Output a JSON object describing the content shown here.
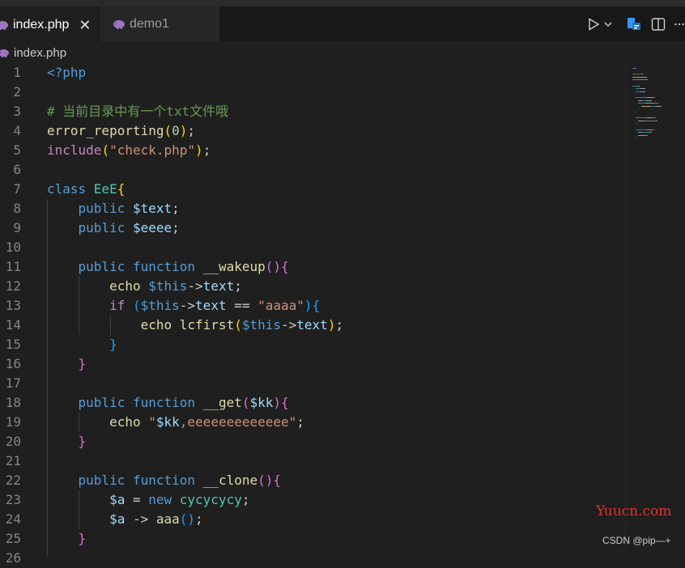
{
  "tabs": [
    {
      "label": "index.php",
      "active": true,
      "close_glyph": "✕",
      "icon": "php-elephant-icon"
    },
    {
      "label": "demo1",
      "active": false,
      "icon": "php-elephant-icon"
    }
  ],
  "breadcrumb": {
    "file": "index.php",
    "icon": "php-elephant-icon"
  },
  "actions": [
    "run-icon",
    "run-dropdown-icon",
    "remote-explorer-icon",
    "split-editor-icon",
    "more-actions-icon"
  ],
  "colors": {
    "editor_bg": "#1f1f1f",
    "keyword_blue": "#569cd6",
    "keyword_purple": "#c586c0",
    "variable": "#9cdcfe",
    "function": "#dcdcaa",
    "string": "#ce9178",
    "comment": "#6a9955",
    "number": "#b5cea8",
    "class": "#4ec9b0",
    "bracket_gold": "#ffd700",
    "bracket_pink": "#da70d6",
    "bracket_blue": "#179fff"
  },
  "code_lines": [
    {
      "n": "1",
      "tokens": [
        {
          "t": "<?php",
          "c": "#569cd6"
        }
      ]
    },
    {
      "n": "2",
      "tokens": []
    },
    {
      "n": "3",
      "tokens": [
        {
          "t": "# 当前目录中有一个txt文件哦",
          "c": "#6a9955"
        }
      ]
    },
    {
      "n": "4",
      "tokens": [
        {
          "t": "error_reporting",
          "c": "#dcdcaa"
        },
        {
          "t": "(",
          "c": "#ffd700"
        },
        {
          "t": "0",
          "c": "#b5cea8"
        },
        {
          "t": ")",
          "c": "#ffd700"
        },
        {
          "t": ";",
          "c": "#cccccc"
        }
      ]
    },
    {
      "n": "5",
      "tokens": [
        {
          "t": "include",
          "c": "#c586c0"
        },
        {
          "t": "(",
          "c": "#ffd700"
        },
        {
          "t": "\"check.php\"",
          "c": "#ce9178"
        },
        {
          "t": ")",
          "c": "#ffd700"
        },
        {
          "t": ";",
          "c": "#cccccc"
        }
      ]
    },
    {
      "n": "6",
      "tokens": []
    },
    {
      "n": "7",
      "tokens": [
        {
          "t": "class ",
          "c": "#569cd6"
        },
        {
          "t": "EeE",
          "c": "#4ec9b0"
        },
        {
          "t": "{",
          "c": "#ffd700"
        }
      ]
    },
    {
      "n": "8",
      "tokens": [
        {
          "t": "    ",
          "c": "#cccccc"
        },
        {
          "t": "public ",
          "c": "#569cd6"
        },
        {
          "t": "$text",
          "c": "#9cdcfe"
        },
        {
          "t": ";",
          "c": "#cccccc"
        }
      ]
    },
    {
      "n": "9",
      "tokens": [
        {
          "t": "    ",
          "c": "#cccccc"
        },
        {
          "t": "public ",
          "c": "#569cd6"
        },
        {
          "t": "$eeee",
          "c": "#9cdcfe"
        },
        {
          "t": ";",
          "c": "#cccccc"
        }
      ]
    },
    {
      "n": "10",
      "tokens": []
    },
    {
      "n": "11",
      "tokens": [
        {
          "t": "    ",
          "c": "#cccccc"
        },
        {
          "t": "public ",
          "c": "#569cd6"
        },
        {
          "t": "function ",
          "c": "#569cd6"
        },
        {
          "t": "__wakeup",
          "c": "#dcdcaa"
        },
        {
          "t": "()",
          "c": "#da70d6"
        },
        {
          "t": "{",
          "c": "#da70d6"
        }
      ]
    },
    {
      "n": "12",
      "tokens": [
        {
          "t": "        ",
          "c": "#cccccc"
        },
        {
          "t": "echo ",
          "c": "#dcdcaa"
        },
        {
          "t": "$this",
          "c": "#569cd6"
        },
        {
          "t": "->",
          "c": "#cccccc"
        },
        {
          "t": "text",
          "c": "#9cdcfe"
        },
        {
          "t": ";",
          "c": "#cccccc"
        }
      ]
    },
    {
      "n": "13",
      "tokens": [
        {
          "t": "        ",
          "c": "#cccccc"
        },
        {
          "t": "if ",
          "c": "#c586c0"
        },
        {
          "t": "(",
          "c": "#179fff"
        },
        {
          "t": "$this",
          "c": "#569cd6"
        },
        {
          "t": "->",
          "c": "#cccccc"
        },
        {
          "t": "text",
          "c": "#9cdcfe"
        },
        {
          "t": " == ",
          "c": "#cccccc"
        },
        {
          "t": "\"aaaa\"",
          "c": "#ce9178"
        },
        {
          "t": ")",
          "c": "#179fff"
        },
        {
          "t": "{",
          "c": "#179fff"
        }
      ]
    },
    {
      "n": "14",
      "tokens": [
        {
          "t": "            ",
          "c": "#cccccc"
        },
        {
          "t": "echo ",
          "c": "#dcdcaa"
        },
        {
          "t": "lcfirst",
          "c": "#dcdcaa"
        },
        {
          "t": "(",
          "c": "#ffd700"
        },
        {
          "t": "$this",
          "c": "#569cd6"
        },
        {
          "t": "->",
          "c": "#cccccc"
        },
        {
          "t": "text",
          "c": "#9cdcfe"
        },
        {
          "t": ")",
          "c": "#ffd700"
        },
        {
          "t": ";",
          "c": "#cccccc"
        }
      ]
    },
    {
      "n": "15",
      "tokens": [
        {
          "t": "        ",
          "c": "#cccccc"
        },
        {
          "t": "}",
          "c": "#179fff"
        }
      ]
    },
    {
      "n": "16",
      "tokens": [
        {
          "t": "    ",
          "c": "#cccccc"
        },
        {
          "t": "}",
          "c": "#da70d6"
        }
      ]
    },
    {
      "n": "17",
      "tokens": []
    },
    {
      "n": "18",
      "tokens": [
        {
          "t": "    ",
          "c": "#cccccc"
        },
        {
          "t": "public ",
          "c": "#569cd6"
        },
        {
          "t": "function ",
          "c": "#569cd6"
        },
        {
          "t": "__get",
          "c": "#dcdcaa"
        },
        {
          "t": "(",
          "c": "#da70d6"
        },
        {
          "t": "$kk",
          "c": "#9cdcfe"
        },
        {
          "t": ")",
          "c": "#da70d6"
        },
        {
          "t": "{",
          "c": "#da70d6"
        }
      ]
    },
    {
      "n": "19",
      "tokens": [
        {
          "t": "        ",
          "c": "#cccccc"
        },
        {
          "t": "echo ",
          "c": "#dcdcaa"
        },
        {
          "t": "\"",
          "c": "#ce9178"
        },
        {
          "t": "$kk",
          "c": "#9cdcfe"
        },
        {
          "t": ",eeeeeeeeeeeee\"",
          "c": "#ce9178"
        },
        {
          "t": ";",
          "c": "#cccccc"
        }
      ]
    },
    {
      "n": "20",
      "tokens": [
        {
          "t": "    ",
          "c": "#cccccc"
        },
        {
          "t": "}",
          "c": "#da70d6"
        }
      ]
    },
    {
      "n": "21",
      "tokens": []
    },
    {
      "n": "22",
      "tokens": [
        {
          "t": "    ",
          "c": "#cccccc"
        },
        {
          "t": "public ",
          "c": "#569cd6"
        },
        {
          "t": "function ",
          "c": "#569cd6"
        },
        {
          "t": "__clone",
          "c": "#dcdcaa"
        },
        {
          "t": "()",
          "c": "#da70d6"
        },
        {
          "t": "{",
          "c": "#da70d6"
        }
      ]
    },
    {
      "n": "23",
      "tokens": [
        {
          "t": "        ",
          "c": "#cccccc"
        },
        {
          "t": "$a",
          "c": "#9cdcfe"
        },
        {
          "t": " = ",
          "c": "#cccccc"
        },
        {
          "t": "new ",
          "c": "#569cd6"
        },
        {
          "t": "cycycycy",
          "c": "#4ec9b0"
        },
        {
          "t": ";",
          "c": "#cccccc"
        }
      ]
    },
    {
      "n": "24",
      "tokens": [
        {
          "t": "        ",
          "c": "#cccccc"
        },
        {
          "t": "$a",
          "c": "#9cdcfe"
        },
        {
          "t": " -> ",
          "c": "#cccccc"
        },
        {
          "t": "aaa",
          "c": "#dcdcaa"
        },
        {
          "t": "()",
          "c": "#179fff"
        },
        {
          "t": ";",
          "c": "#cccccc"
        }
      ]
    },
    {
      "n": "25",
      "tokens": [
        {
          "t": "    ",
          "c": "#cccccc"
        },
        {
          "t": "}",
          "c": "#da70d6"
        }
      ]
    },
    {
      "n": "26",
      "tokens": []
    }
  ],
  "watermarks": {
    "site": "Yuucn.com",
    "csdn": "CSDN @pip—+"
  }
}
